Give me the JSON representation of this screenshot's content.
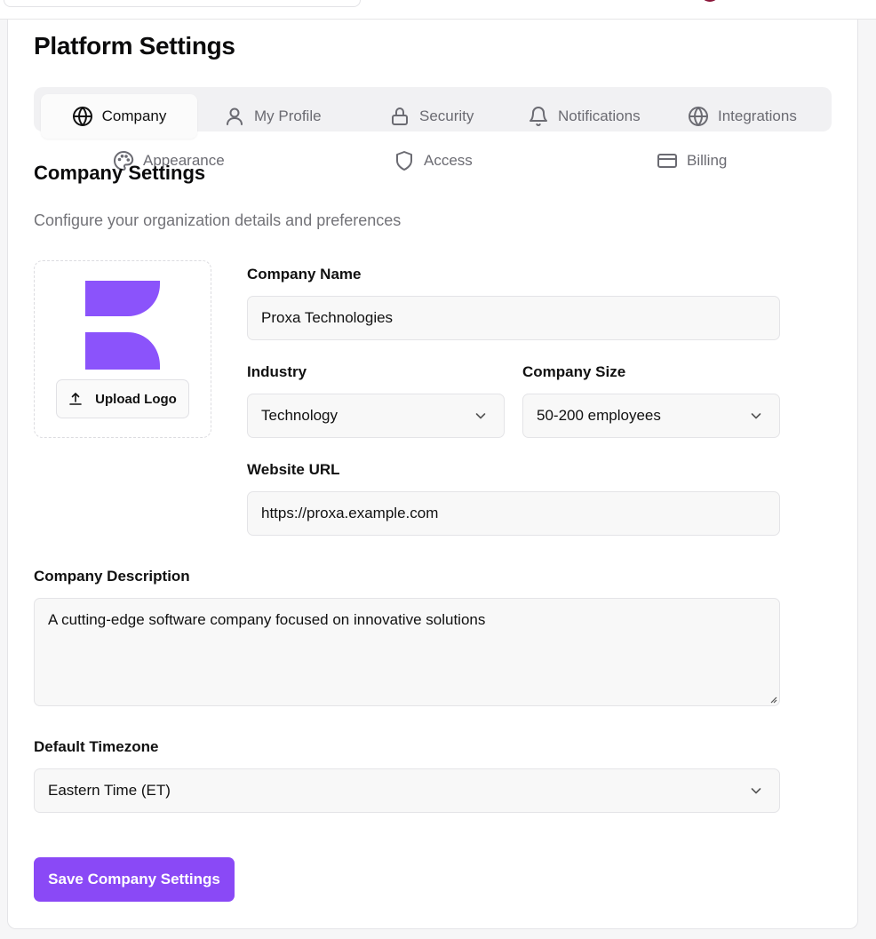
{
  "page": {
    "title": "Platform Settings"
  },
  "tabs": [
    {
      "label": "Company",
      "icon": "globe-icon",
      "active": true
    },
    {
      "label": "My Profile",
      "icon": "user-icon"
    },
    {
      "label": "Security",
      "icon": "lock-icon"
    },
    {
      "label": "Notifications",
      "icon": "bell-icon"
    },
    {
      "label": "Integrations",
      "icon": "globe-icon"
    },
    {
      "label": "Appearance",
      "icon": "palette-icon"
    },
    {
      "label": "Access",
      "icon": "shield-icon"
    },
    {
      "label": "Billing",
      "icon": "credit-card-icon"
    }
  ],
  "section": {
    "title": "Company Settings",
    "subtitle": "Configure your organization details and preferences"
  },
  "logo": {
    "upload_label": "Upload Logo",
    "brand_color": "#8b53fb"
  },
  "form": {
    "company_name": {
      "label": "Company Name",
      "value": "Proxa Technologies"
    },
    "industry": {
      "label": "Industry",
      "value": "Technology"
    },
    "company_size": {
      "label": "Company Size",
      "value": "50-200 employees"
    },
    "website": {
      "label": "Website URL",
      "value": "https://proxa.example.com"
    },
    "description": {
      "label": "Company Description",
      "value": "A cutting-edge software company focused on innovative solutions"
    },
    "timezone": {
      "label": "Default Timezone",
      "value": "Eastern Time (ET)"
    }
  },
  "actions": {
    "save_label": "Save Company Settings"
  },
  "colors": {
    "accent": "#8a49f6",
    "tab_bg": "#f1f1f3",
    "muted_text": "#737378"
  }
}
